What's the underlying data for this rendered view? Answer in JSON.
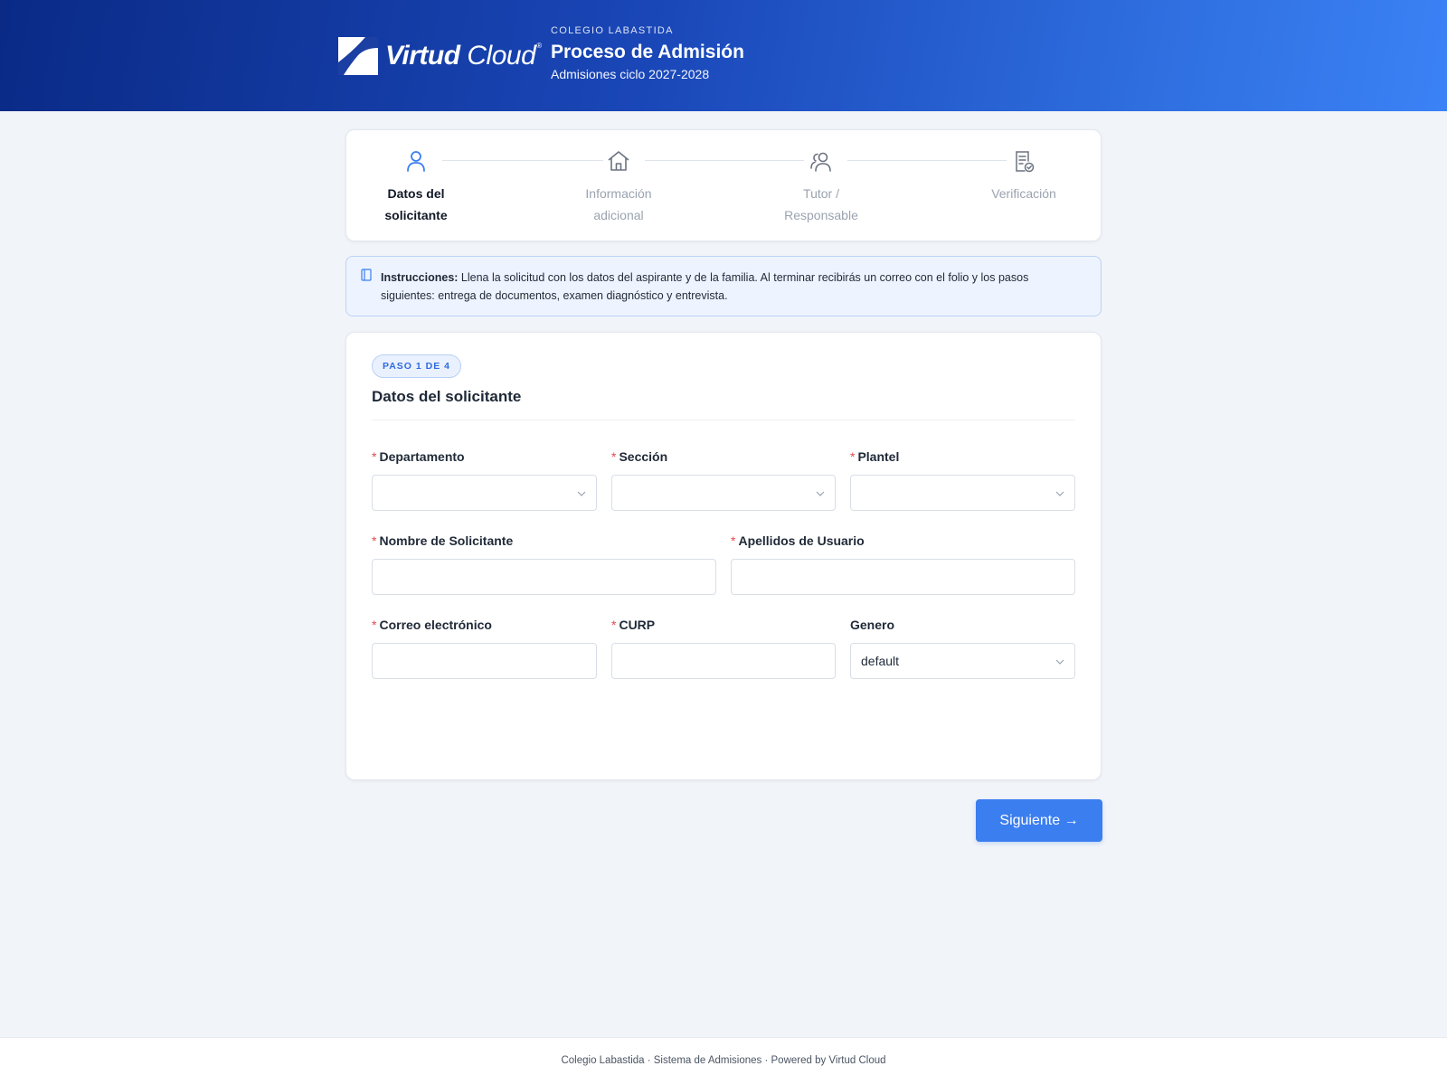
{
  "header": {
    "logo": {
      "brand_bold": "Virtud",
      "brand_light": "Cloud",
      "registered": "®"
    },
    "school": "COLEGIO LABASTIDA",
    "title": "Proceso de Admisión",
    "subtitle": "Admisiones ciclo 2027-2028"
  },
  "stepper": {
    "steps": [
      {
        "line1": "Datos del",
        "line2": "solicitante",
        "icon": "user-icon",
        "active": true
      },
      {
        "line1": "Información",
        "line2": "adicional",
        "icon": "house-icon",
        "active": false
      },
      {
        "line1": "Tutor /",
        "line2": "Responsable",
        "icon": "users-icon",
        "active": false
      },
      {
        "line1": "Verificación",
        "line2": "",
        "icon": "document-check-icon",
        "active": false
      }
    ]
  },
  "instructions": {
    "label": "Instrucciones:",
    "text": " Llena la solicitud con los datos del aspirante y de la familia. Al terminar recibirás un correo con el folio y los pasos siguientes: entrega de documentos, examen diagnóstico y entrevista.",
    "icon": "book-icon"
  },
  "form": {
    "badge": "PASO 1 DE 4",
    "title": "Datos del solicitante",
    "required_mark": "*",
    "fields": {
      "departamento": {
        "label": "Departamento",
        "value": ""
      },
      "seccion": {
        "label": "Sección",
        "value": ""
      },
      "plantel": {
        "label": "Plantel",
        "value": ""
      },
      "nombre": {
        "label": "Nombre de Solicitante",
        "value": ""
      },
      "apellidos": {
        "label": "Apellidos de Usuario",
        "value": ""
      },
      "correo": {
        "label": "Correo electrónico",
        "value": ""
      },
      "curp": {
        "label": "CURP",
        "value": ""
      },
      "genero": {
        "label": "Genero",
        "value": "default"
      }
    }
  },
  "actions": {
    "next_label": "Siguiente →"
  },
  "footer": {
    "text": "Colegio Labastida · Sistema de Admisiones · Powered by Virtud Cloud"
  },
  "colors": {
    "primary": "#3b7ef0",
    "header_dark": "#0a2a86",
    "required": "#e5484d",
    "background": "#f1f4f9"
  }
}
